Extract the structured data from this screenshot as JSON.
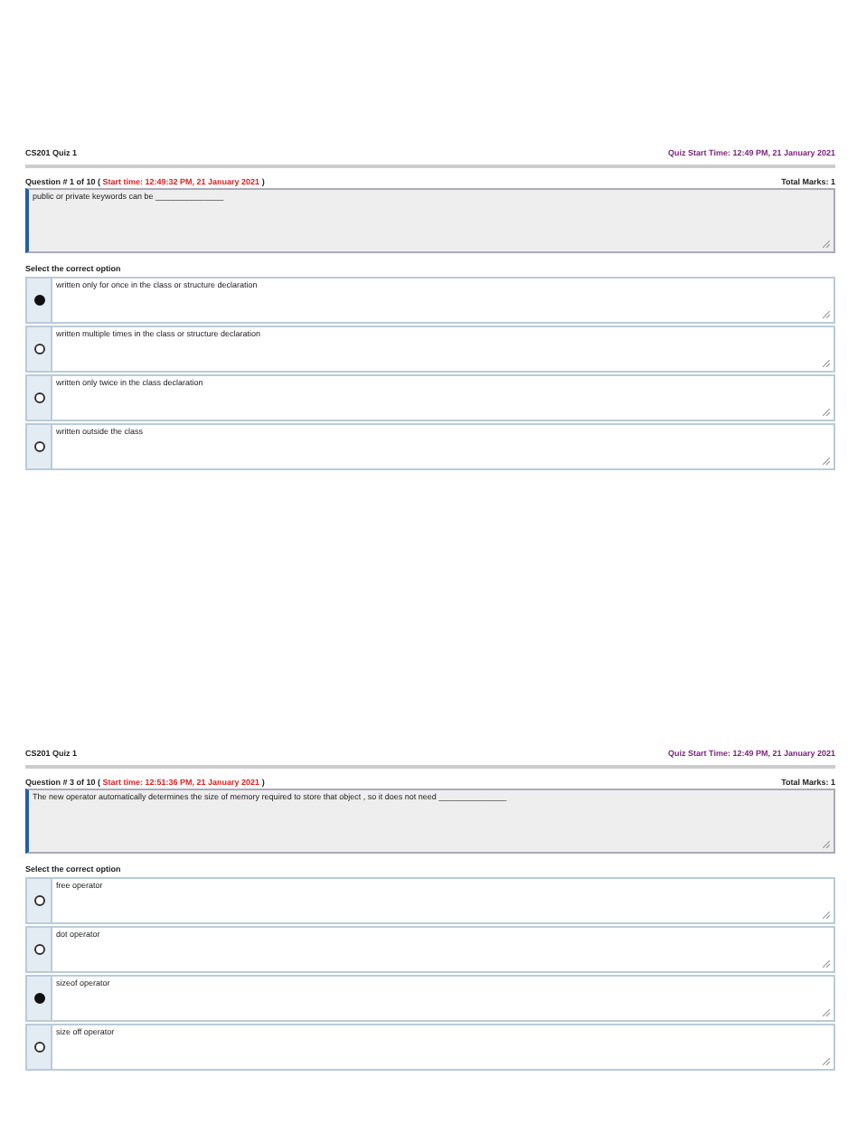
{
  "quizzes": [
    {
      "quiz_title": "CS201 Quiz 1",
      "quiz_start": "Quiz Start Time: 12:49 PM, 21 January 2021",
      "question_heading": {
        "prefix": "Question # 1 of 10 (",
        "start_time": "Start time: 12:49:32 PM, 21 January 2021",
        "suffix": ")"
      },
      "total_marks": "Total Marks: 1",
      "question_text": "public or private keywords can be _______________",
      "prompt": "Select the correct option",
      "options": [
        {
          "text": "written only for once in the class or structure declaration",
          "selected": true
        },
        {
          "text": "written multiple times in the class or structure declaration",
          "selected": false
        },
        {
          "text": "written only twice in the class declaration",
          "selected": false
        },
        {
          "text": "written outside the class",
          "selected": false
        }
      ]
    },
    {
      "quiz_title": "CS201 Quiz 1",
      "quiz_start": "Quiz Start Time: 12:49 PM, 21 January 2021",
      "question_heading": {
        "prefix": "Question # 3 of 10 (",
        "start_time": "Start time: 12:51:36 PM, 21 January 2021",
        "suffix": ")"
      },
      "total_marks": "Total Marks: 1",
      "question_text": "The new operator automatically determines the size of memory required to store that object , so it does not need _______________",
      "prompt": "Select the correct option",
      "options": [
        {
          "text": "free operator",
          "selected": false
        },
        {
          "text": "dot operator",
          "selected": false
        },
        {
          "text": "sizeof operator",
          "selected": true
        },
        {
          "text": "size off operator",
          "selected": false
        }
      ]
    }
  ]
}
